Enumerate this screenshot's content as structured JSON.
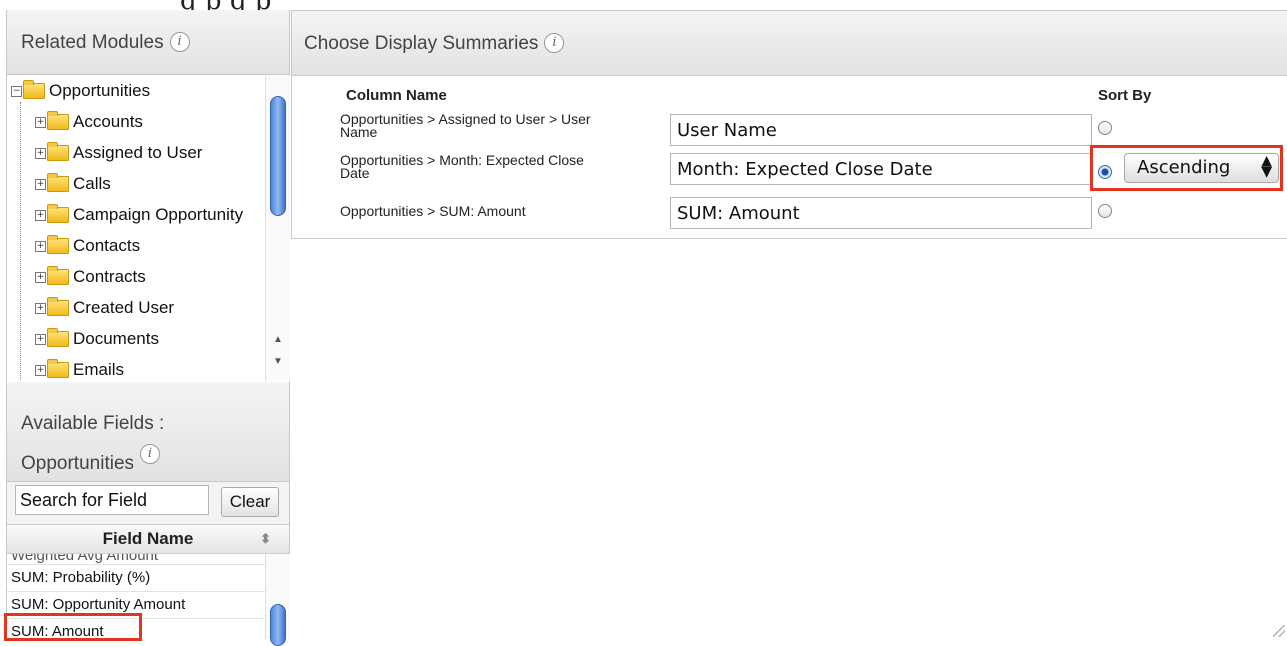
{
  "top_caption": "g         p g  p",
  "related_modules": {
    "title": "Related Modules",
    "info_glyph": "i",
    "tree": [
      {
        "label": "Opportunities",
        "expander": "⊟",
        "depth": 0,
        "open": true
      },
      {
        "label": "Accounts",
        "expander": "⊞",
        "depth": 1
      },
      {
        "label": "Assigned to User",
        "expander": "⊞",
        "depth": 1
      },
      {
        "label": "Calls",
        "expander": "⊞",
        "depth": 1
      },
      {
        "label": "Campaign Opportunity",
        "expander": "⊞",
        "depth": 1
      },
      {
        "label": "Contacts",
        "expander": "⊞",
        "depth": 1
      },
      {
        "label": "Contracts",
        "expander": "⊞",
        "depth": 1
      },
      {
        "label": "Created User",
        "expander": "⊞",
        "depth": 1
      },
      {
        "label": "Documents",
        "expander": "⊞",
        "depth": 1
      },
      {
        "label": "Emails",
        "expander": "⊞",
        "depth": 1
      }
    ]
  },
  "available_fields": {
    "title_line1": "Available Fields :",
    "title_line2": "Opportunities",
    "search_value": "Search for Field",
    "clear_label": "Clear",
    "column_header": "Field Name",
    "rows": [
      "Weighted Avg Amount",
      "SUM: Probability (%)",
      "SUM: Opportunity Amount",
      "SUM: Amount"
    ]
  },
  "display_summaries": {
    "title": "Choose Display Summaries",
    "column_name_header": "Column Name",
    "sort_by_header": "Sort By",
    "rows": [
      {
        "label_line1": "Opportunities > Assigned to User > User",
        "label_line2": "Name",
        "value": "User Name",
        "sort_selected": false
      },
      {
        "label_line1": "Opportunities > Month: Expected Close",
        "label_line2": "Date",
        "value": "Month: Expected Close Date",
        "sort_selected": true
      },
      {
        "label_line1": "Opportunities > SUM: Amount",
        "label_line2": "",
        "value": "SUM: Amount",
        "sort_selected": false
      }
    ],
    "sort_order": "Ascending",
    "sort_arrows": "▲▼"
  },
  "colors": {
    "highlight": "#e5341c",
    "scroll_thumb": "#4f86d6"
  }
}
